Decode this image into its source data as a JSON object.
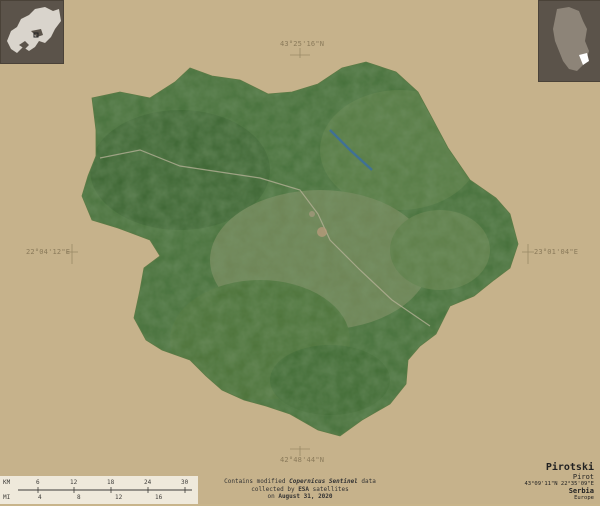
{
  "title": "Pirotski",
  "region": "Pirot",
  "center_coords": "43°09'11\"N 22°35'09\"E",
  "country": "Serbia",
  "continent": "Europe",
  "coords": {
    "top": "43°25'16\"N",
    "bottom": "42°48'44\"N",
    "left": "22°04'12\"E",
    "right": "23°01'04\"E"
  },
  "credits": {
    "line1_pre": "Contains modified ",
    "line1_em": "Copernicus Sentinel",
    "line1_post": " data",
    "line2_pre": "collected by ",
    "line2_em": "ESA",
    "line2_post": " satellites",
    "line3_pre": "on ",
    "line3_em": "August 31, 2020"
  },
  "scale": {
    "km_label": "KM",
    "mi_label": "MI",
    "km_ticks": [
      "0",
      "6",
      "12",
      "18",
      "24",
      "30"
    ],
    "mi_ticks": [
      "0",
      "4",
      "8",
      "12",
      "16"
    ]
  },
  "colors": {
    "background": "#c6b28b",
    "forest": "#3f6a35",
    "field": "#6e8a55",
    "inset": "#5a5248"
  }
}
